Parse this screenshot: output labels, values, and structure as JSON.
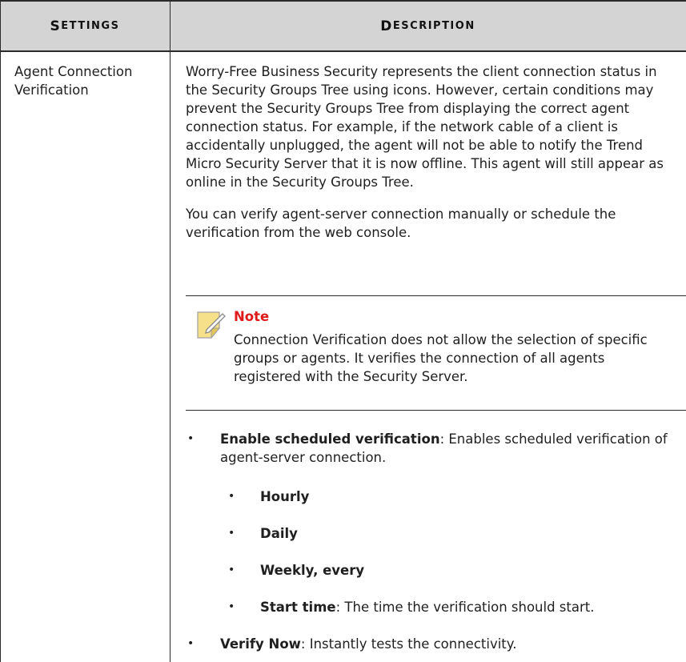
{
  "header": {
    "settings_first": "S",
    "settings_rest": "ETTINGS",
    "description_first": "D",
    "description_rest": "ESCRIPTION"
  },
  "row": {
    "setting_name": "Agent Connection Verification",
    "para1": "Worry-Free Business Security represents the client connection status in the Security Groups Tree using icons. However, certain conditions may prevent the Security Groups Tree from displaying the correct agent connection status. For example, if the network cable of a client is accidentally unplugged, the agent will not be able to notify the Trend Micro Security Server that it is now offline. This agent will still appear as online in the Security Groups Tree.",
    "para2": "You can verify agent-server connection manually or schedule the verification from the web console.",
    "note_title": "Note",
    "note_text": "Connection Verification does not allow the selection of specific groups or agents. It verifies the connection of all agents registered with the Security Server.",
    "bullets": {
      "enable_label": "Enable scheduled verification",
      "enable_text": ": Enables scheduled verification of agent-server connection.",
      "hourly": "Hourly",
      "daily": "Daily",
      "weekly": "Weekly, every",
      "start_label": "Start time",
      "start_text": ": The time the verification should start.",
      "verify_label": "Verify Now",
      "verify_text": ": Instantly tests the connectivity."
    },
    "bullet_glyph": "•"
  },
  "colors": {
    "header_bg": "#d4d4d4",
    "note_title": "#e01a1a",
    "note_icon_fill": "#f6e08a"
  }
}
